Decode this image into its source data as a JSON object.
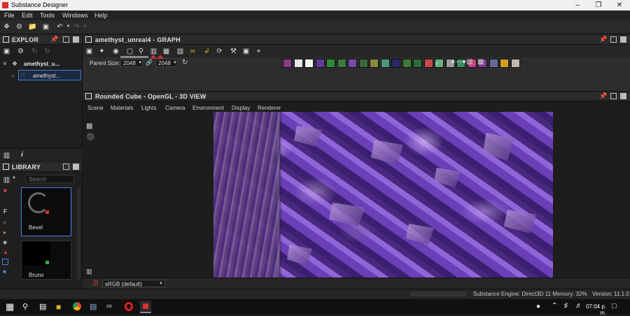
{
  "app": {
    "title": "Substance Designer",
    "icon_color": "#d9312b"
  },
  "menu": [
    "File",
    "Edit",
    "Tools",
    "Windows",
    "Help"
  ],
  "explorer": {
    "title": "EXPLOR",
    "package": "amethyst_u...",
    "graph_item": "amethyst..."
  },
  "graph": {
    "title": "amethyst_unreal4 - GRAPH",
    "parent_size_label": "Parent Size:",
    "parent_size_value": "2048",
    "size_value": "2048",
    "chip_colors": [
      "#8a3a88",
      "#e8e8e8",
      "#f2f2f2",
      "#5f3c9a",
      "#2f8a3a",
      "#3a7a3a",
      "#7a4aa8",
      "#3a6a3a",
      "#8a8a3a",
      "#4a9a7a",
      "#2a2a6a",
      "#3a7a3a",
      "#2f6b3a",
      "#c84a4a",
      "#6ab07a",
      "#9aa0a0",
      "#3a8a5a",
      "#c04080",
      "#7a3a9a",
      "#6a6a9a",
      "#d8a020",
      "#c0b8b0"
    ]
  },
  "view3d": {
    "title": "Rounded Cube - OpenGL - 3D VIEW",
    "menus": [
      "Scene",
      "Materials",
      "Lights",
      "Camera",
      "Environment",
      "Display",
      "Renderer"
    ],
    "colorspace": "sRGB (default)"
  },
  "library": {
    "title": "LIBRARY",
    "search_placeholder": "Search",
    "items": [
      {
        "label": "Bevel"
      },
      {
        "label": "Bruno"
      }
    ]
  },
  "status": {
    "engine": "Substance Engine: Direct3D 11  Memory: 32%",
    "version": "Version: 11.1.0"
  },
  "taskbar": {
    "time": "07:04 p. m.",
    "icons": [
      "windows-icon",
      "search-icon",
      "taskview-icon",
      "explorer-icon",
      "chrome-icon",
      "app-icon",
      "app2-icon",
      "opera-icon",
      "substance-icon"
    ]
  }
}
